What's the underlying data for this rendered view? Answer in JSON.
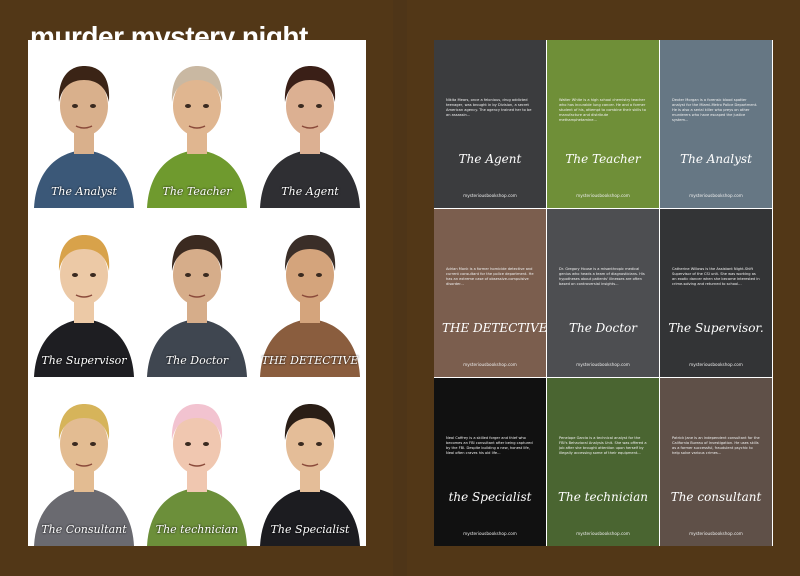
{
  "poster": {
    "title": "murder mystery night",
    "portraits": [
      {
        "label": "The Analyst",
        "shirt": "#3b5878",
        "skin": "#d9b08c",
        "hair": "#3b2416"
      },
      {
        "label": "The Teacher",
        "shirt": "#6f9a2e",
        "skin": "#e0b690",
        "hair": "#c9b8a2"
      },
      {
        "label": "The Agent",
        "shirt": "#2f2f33",
        "skin": "#dcb092",
        "hair": "#3a1f17"
      },
      {
        "label": "The Supervisor",
        "shirt": "#1e1e22",
        "skin": "#ecc9a6",
        "hair": "#d8a24a"
      },
      {
        "label": "The Doctor",
        "shirt": "#3f4650",
        "skin": "#d6ad8a",
        "hair": "#3b2a20"
      },
      {
        "label": "THE DETECTIVE",
        "shirt": "#8a5d3e",
        "skin": "#d4a47c",
        "hair": "#3a2e28"
      },
      {
        "label": "The Consultant",
        "shirt": "#6a6a70",
        "skin": "#e3bc92",
        "hair": "#d6b45a"
      },
      {
        "label": "The technician",
        "shirt": "#6c8f3a",
        "skin": "#f0c7b0",
        "hair": "#f2c3d0"
      },
      {
        "label": "The Specialist",
        "shirt": "#1c1c20",
        "skin": "#e4bd98",
        "hair": "#2a1e16"
      }
    ]
  },
  "cards": [
    {
      "color": "#3b3c3e",
      "bio": "Nikita Mears, once a felonious, drug addicted teenager, was brought in by Division, a secret American agency. The agency trained her to be an assassin...",
      "role": "The Agent",
      "site": "mysteriousbookshop.com"
    },
    {
      "color": "#6f8f38",
      "bio": "Walter White is a high school chemistry teacher who has incurable lung cancer. He and a former student of his, attempt to combine their skills to manufacture and distribute methamphetamine...",
      "role": "The Teacher",
      "site": "mysteriousbookshop.com"
    },
    {
      "color": "#667784",
      "bio": "Dexter Morgan is a forensic blood spatter analyst for the Miami-Metro Police Department. He is also a serial killer who preys on other murderers who have escaped the justice system...",
      "role": "The Analyst",
      "site": "mysteriousbookshop.com"
    },
    {
      "color": "#7b5e4e",
      "bio": "Adrian Monk is a former homicide detective and current consultant for the police department. He has an extreme case of obsessive-compulsive disorder...",
      "role": "THE DETECTIVE",
      "site": "mysteriousbookshop.com"
    },
    {
      "color": "#4d4e51",
      "bio": "Dr. Gregory House is a misanthropic medical genius who heads a team of diagnosticians. His hypotheses about patients' illnesses are often based on controversial insights...",
      "role": "The Doctor",
      "site": "mysteriousbookshop.com"
    },
    {
      "color": "#333436",
      "bio": "Catherine Willows is the Assistant Night-Shift Supervisor of the CSI unit. She was working as an exotic dancer when she became interested in crime-solving and returned to school...",
      "role": "The Supervisor.",
      "site": "mysteriousbookshop.com"
    },
    {
      "color": "#111111",
      "bio": "Neal Caffrey is a skilled forger and thief who becomes an FBI consultant after being captured by the FBI. Despite building a new, honest life, Neal often craves his old life...",
      "role": "the Specialist",
      "site": "mysteriousbookshop.com"
    },
    {
      "color": "#4a6531",
      "bio": "Penelope Garcia is a technical analyst for the FBI's Behavioral Analysis Unit. She was offered a job after she brought attention upon herself by illegally accessing some of their equipment...",
      "role": "The technician",
      "site": "mysteriousbookshop.com"
    },
    {
      "color": "#5f5048",
      "bio": "Patrick Jane is an independent consultant for the California Bureau of Investigation. He uses skills as a former successful, fraudulent psychic to help solve various crimes...",
      "role": "The consultant",
      "site": "mysteriousbookshop.com"
    }
  ]
}
